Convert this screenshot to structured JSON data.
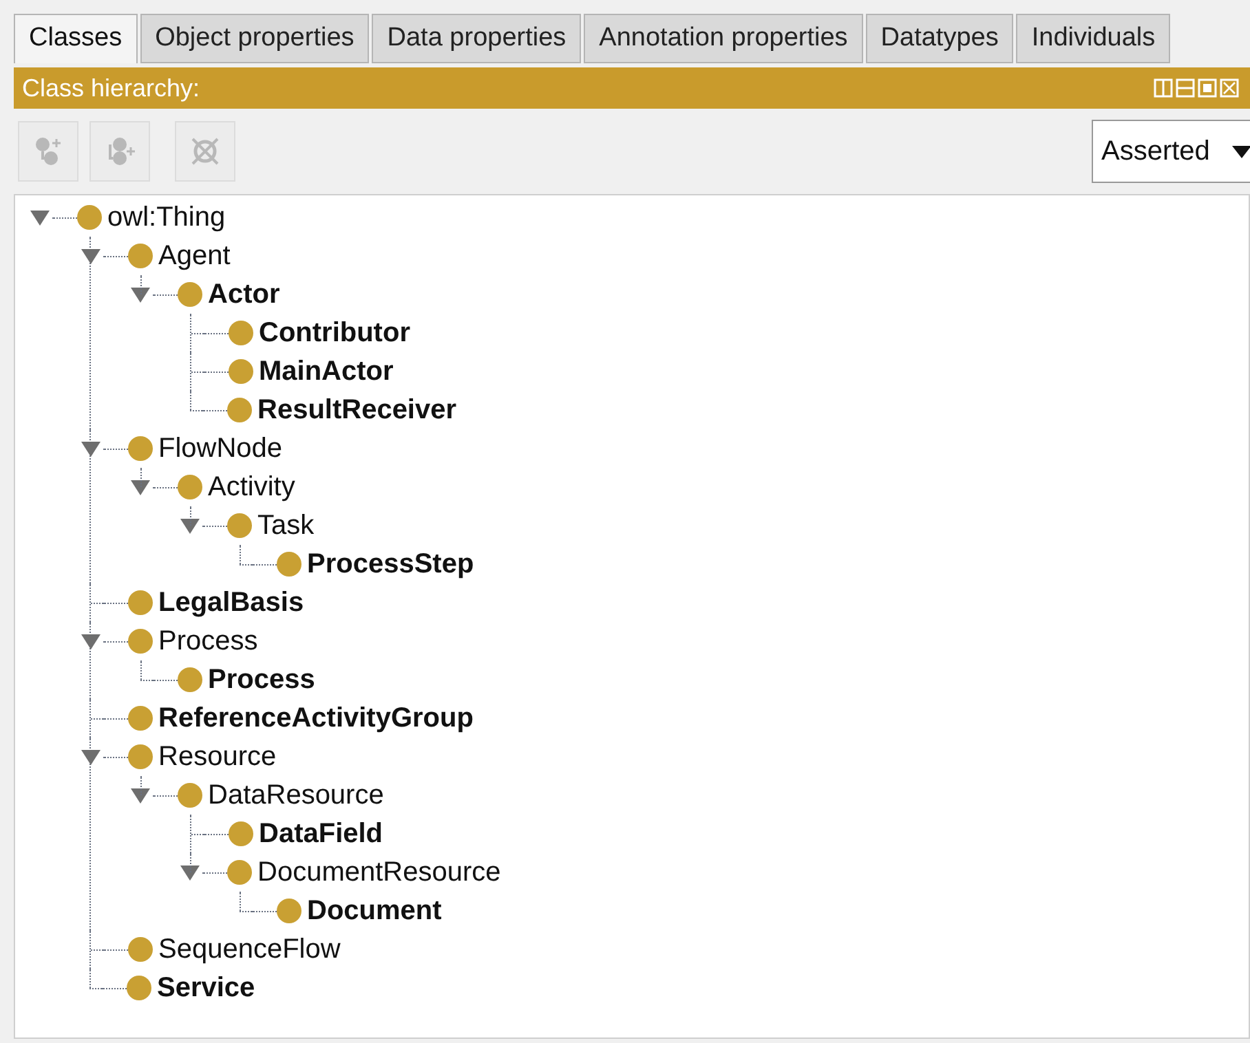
{
  "tabs": [
    {
      "label": "Classes",
      "selected": true
    },
    {
      "label": "Object properties",
      "selected": false
    },
    {
      "label": "Data properties",
      "selected": false
    },
    {
      "label": "Annotation properties",
      "selected": false
    },
    {
      "label": "Datatypes",
      "selected": false
    },
    {
      "label": "Individuals",
      "selected": false
    }
  ],
  "panel": {
    "title": "Class hierarchy:"
  },
  "toolbar": {
    "buttons": [
      {
        "kind": "add-subclass",
        "disabled": true
      },
      {
        "kind": "add-sibling",
        "disabled": true
      },
      {
        "kind": "delete",
        "disabled": true
      }
    ],
    "view_select": {
      "value": "Asserted"
    }
  },
  "tree": [
    {
      "label": "owl:Thing",
      "defined": false,
      "expanded": true,
      "children": [
        {
          "label": "Agent",
          "defined": false,
          "expanded": true,
          "children": [
            {
              "label": "Actor",
              "defined": true,
              "expanded": true,
              "children": [
                {
                  "label": "Contributor",
                  "defined": true
                },
                {
                  "label": "MainActor",
                  "defined": true
                },
                {
                  "label": "ResultReceiver",
                  "defined": true
                }
              ]
            }
          ]
        },
        {
          "label": "FlowNode",
          "defined": false,
          "expanded": true,
          "children": [
            {
              "label": "Activity",
              "defined": false,
              "expanded": true,
              "children": [
                {
                  "label": "Task",
                  "defined": false,
                  "expanded": true,
                  "children": [
                    {
                      "label": "ProcessStep",
                      "defined": true
                    }
                  ]
                }
              ]
            }
          ]
        },
        {
          "label": "LegalBasis",
          "defined": true
        },
        {
          "label": "Process",
          "defined": false,
          "expanded": true,
          "children": [
            {
              "label": "Process",
              "defined": true
            }
          ]
        },
        {
          "label": "ReferenceActivityGroup",
          "defined": true
        },
        {
          "label": "Resource",
          "defined": false,
          "expanded": true,
          "children": [
            {
              "label": "DataResource",
              "defined": false,
              "expanded": true,
              "children": [
                {
                  "label": "DataField",
                  "defined": true
                },
                {
                  "label": "DocumentResource",
                  "defined": false,
                  "expanded": true,
                  "children": [
                    {
                      "label": "Document",
                      "defined": true
                    }
                  ]
                }
              ]
            }
          ]
        },
        {
          "label": "SequenceFlow",
          "defined": false
        },
        {
          "label": "Service",
          "defined": true
        }
      ]
    }
  ]
}
